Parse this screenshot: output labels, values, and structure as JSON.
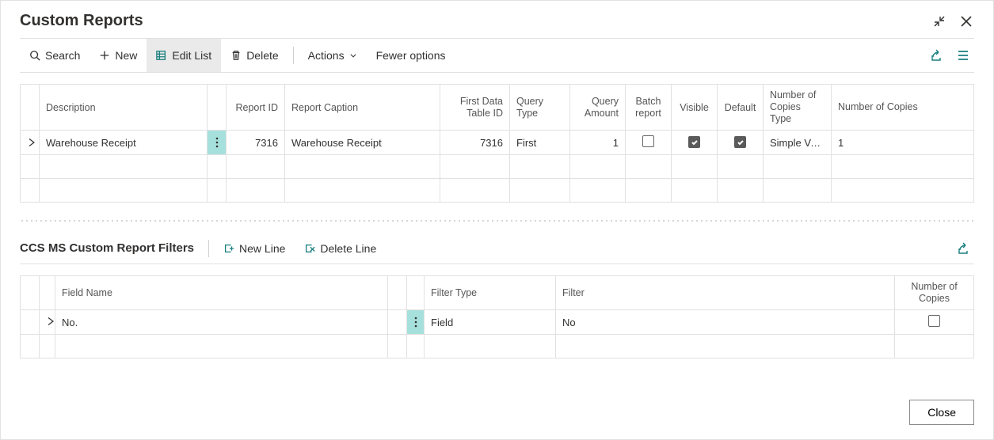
{
  "header": {
    "title": "Custom Reports"
  },
  "toolbar": {
    "search": "Search",
    "new": "New",
    "edit_list": "Edit List",
    "delete": "Delete",
    "actions": "Actions",
    "fewer_options": "Fewer options"
  },
  "table1": {
    "columns": {
      "description": "Description",
      "report_id": "Report ID",
      "report_caption": "Report Caption",
      "first_data_table_id": "First Data Table ID",
      "query_type": "Query Type",
      "query_amount": "Query Amount",
      "batch_report": "Batch report",
      "visible": "Visible",
      "default": "Default",
      "num_copies_type": "Number of Copies Type",
      "num_copies": "Number of Copies"
    },
    "rows": [
      {
        "description": "Warehouse Receipt",
        "report_id": "7316",
        "report_caption": "Warehouse Receipt",
        "first_data_table_id": "7316",
        "query_type": "First",
        "query_amount": "1",
        "batch_report": false,
        "visible": true,
        "default": true,
        "num_copies_type": "Simple Value",
        "num_copies": "1"
      }
    ]
  },
  "section2": {
    "title": "CCS MS Custom Report Filters",
    "new_line": "New Line",
    "delete_line": "Delete Line"
  },
  "table2": {
    "columns": {
      "field_name": "Field Name",
      "filter_type": "Filter Type",
      "filter": "Filter",
      "num_copies": "Number of Copies"
    },
    "rows": [
      {
        "field_name": "No.",
        "filter_type": "Field",
        "filter": "No",
        "num_copies_checked": false
      }
    ]
  },
  "footer": {
    "close": "Close"
  }
}
